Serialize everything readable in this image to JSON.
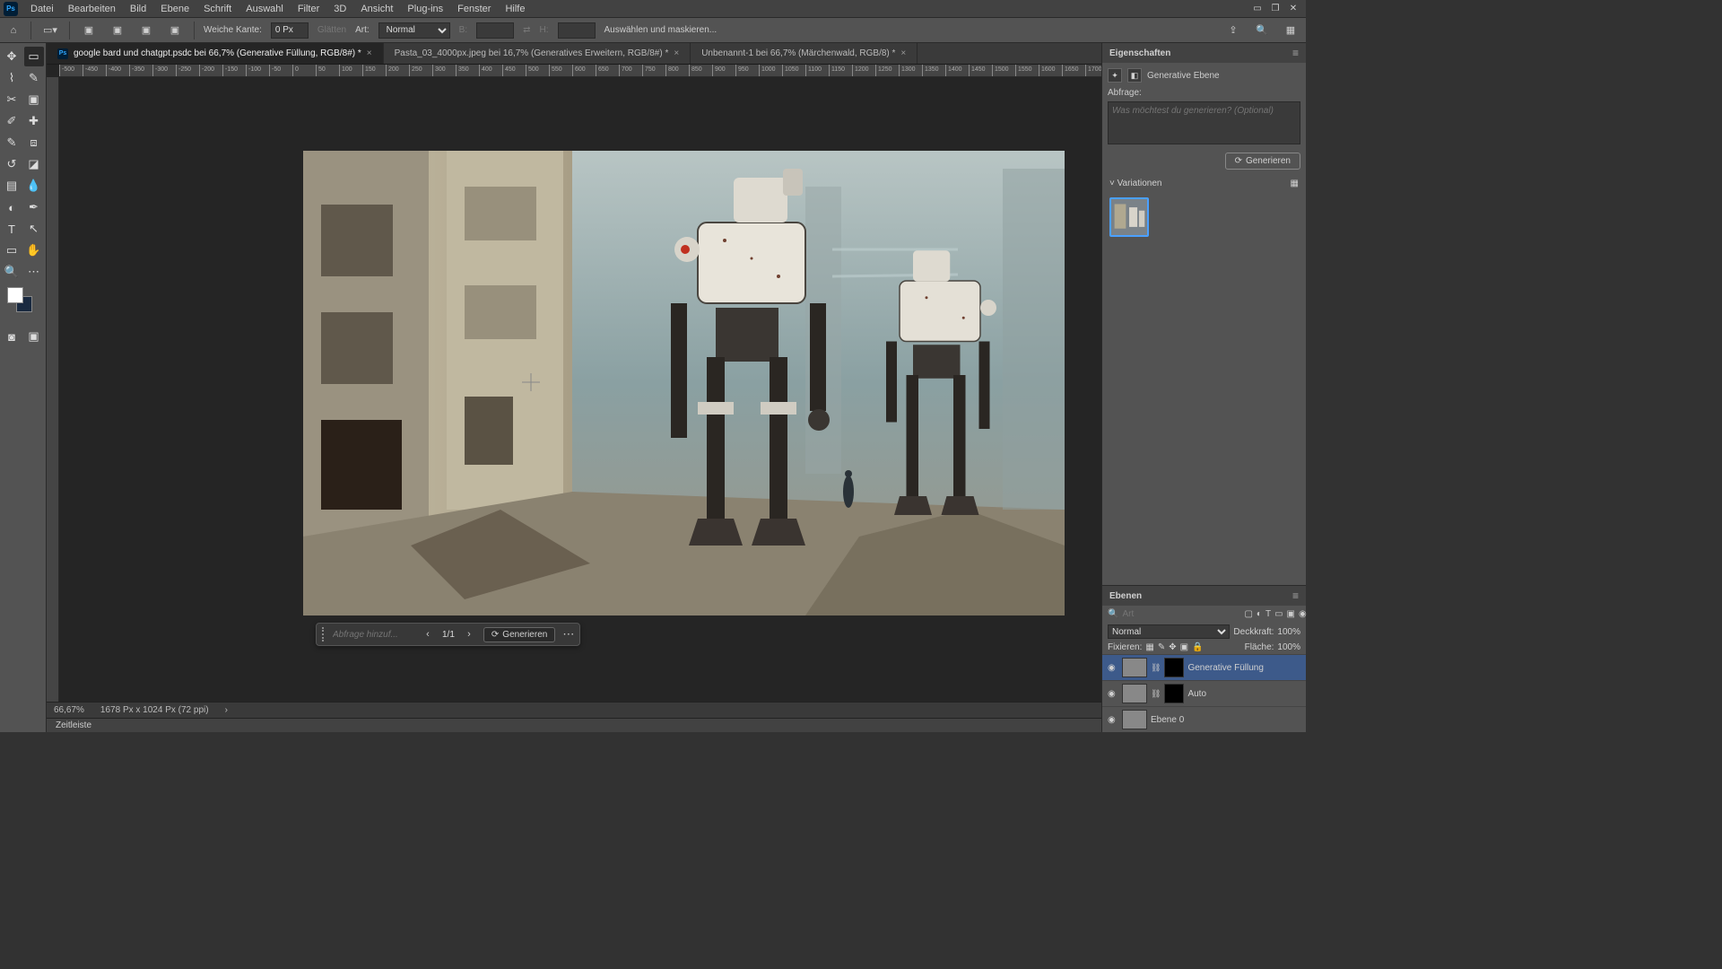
{
  "menu": [
    "Datei",
    "Bearbeiten",
    "Bild",
    "Ebene",
    "Schrift",
    "Auswahl",
    "Filter",
    "3D",
    "Ansicht",
    "Plug-ins",
    "Fenster",
    "Hilfe"
  ],
  "options": {
    "feather_label": "Weiche Kante:",
    "feather_value": "0 Px",
    "antialias": "Glätten",
    "style_label": "Art:",
    "style_value": "Normal",
    "width_label": "B:",
    "height_label": "H:",
    "mask_link": "Auswählen und maskieren..."
  },
  "tabs": [
    {
      "label": "google bard und chatgpt.psdc bei 66,7% (Generative Füllung, RGB/8#) *",
      "active": true,
      "icon": true
    },
    {
      "label": "Pasta_03_4000px.jpeg bei 16,7% (Generatives Erweitern, RGB/8#) *",
      "active": false
    },
    {
      "label": "Unbenannt-1 bei 66,7% (Märchenwald, RGB/8) *",
      "active": false
    }
  ],
  "ruler_ticks": [
    "-500",
    "-450",
    "-400",
    "-350",
    "-300",
    "-250",
    "-200",
    "-150",
    "-100",
    "-50",
    "0",
    "50",
    "100",
    "150",
    "200",
    "250",
    "300",
    "350",
    "400",
    "450",
    "500",
    "550",
    "600",
    "650",
    "700",
    "750",
    "800",
    "850",
    "900",
    "950",
    "1000",
    "1050",
    "1100",
    "1150",
    "1200",
    "1250",
    "1300",
    "1350",
    "1400",
    "1450",
    "1500",
    "1550",
    "1600",
    "1650",
    "1700"
  ],
  "genbar": {
    "prompt_placeholder": "Abfrage hinzuf...",
    "count": "1/1",
    "generate": "Generieren"
  },
  "status": {
    "zoom": "66,67%",
    "docinfo": "1678 Px x 1024 Px (72 ppi)",
    "timeline": "Zeitleiste"
  },
  "props": {
    "title": "Eigenschaften",
    "layer_type": "Generative Ebene",
    "prompt_label": "Abfrage:",
    "prompt_placeholder": "Was möchtest du generieren? (Optional)",
    "generate": "Generieren",
    "variations_label": "Variationen"
  },
  "layers": {
    "title": "Ebenen",
    "search_placeholder": "Art",
    "blend": "Normal",
    "opacity_label": "Deckkraft:",
    "opacity_value": "100%",
    "lock_label": "Fixieren:",
    "fill_label": "Fläche:",
    "fill_value": "100%",
    "items": [
      {
        "name": "Generative Füllung",
        "sel": true,
        "hasLink": true,
        "mask": true
      },
      {
        "name": "Auto",
        "sel": false,
        "hasLink": true,
        "mask": true
      },
      {
        "name": "Ebene 0",
        "sel": false,
        "hasLink": false,
        "mask": false
      }
    ]
  }
}
